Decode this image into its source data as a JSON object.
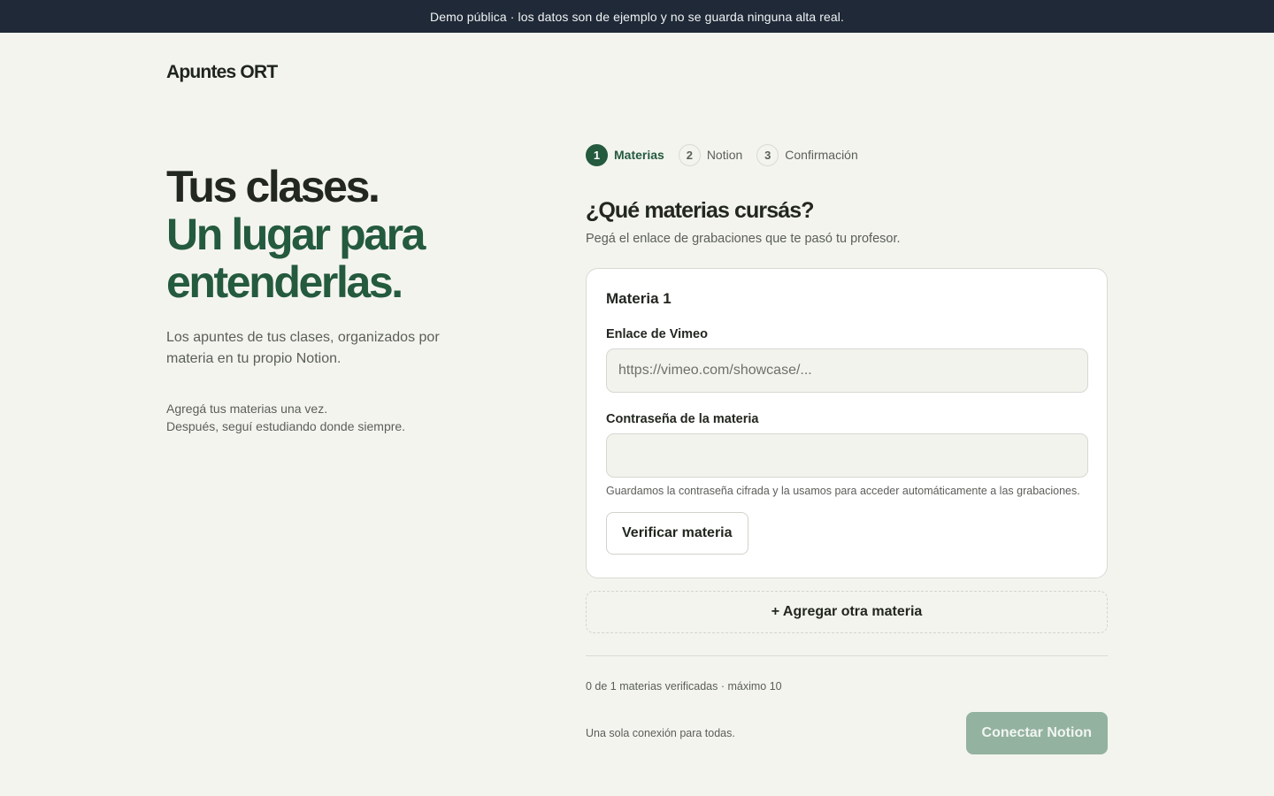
{
  "banner": {
    "text": "Demo pública · los datos son de ejemplo y no se guarda ninguna alta real."
  },
  "brand": {
    "name": "Apuntes ORT"
  },
  "hero": {
    "line1": "Tus clases.",
    "line2": "Un lugar para",
    "line3": "entenderlas.",
    "subtitle": "Los apuntes de tus clases, organizados por materia en tu propio Notion.",
    "note_line1": "Agregá tus materias una vez.",
    "note_line2": "Después, seguí estudiando donde siempre."
  },
  "steps": [
    {
      "number": "1",
      "label": "Materias",
      "active": true
    },
    {
      "number": "2",
      "label": "Notion",
      "active": false
    },
    {
      "number": "3",
      "label": "Confirmación",
      "active": false
    }
  ],
  "form": {
    "title": "¿Qué materias cursás?",
    "subtitle": "Pegá el enlace de grabaciones que te pasó tu profesor.",
    "card": {
      "title": "Materia 1",
      "vimeo_label": "Enlace de Vimeo",
      "vimeo_placeholder": "https://vimeo.com/showcase/...",
      "vimeo_value": "",
      "password_label": "Contraseña de la materia",
      "password_value": "",
      "password_hint": "Guardamos la contraseña cifrada y la usamos para acceder automáticamente a las grabaciones.",
      "verify_button": "Verificar materia"
    },
    "add_button": "+ Agregar otra materia",
    "count_text": "0 de 1 materias verificadas · máximo 10",
    "footer_note": "Una sola conexión para todas.",
    "connect_button": "Conectar Notion",
    "connect_enabled": false
  },
  "colors": {
    "accent": "#245a3e",
    "banner_bg": "#1f2937",
    "page_bg": "#f4f4ef",
    "connect_disabled": "#93b29f"
  }
}
